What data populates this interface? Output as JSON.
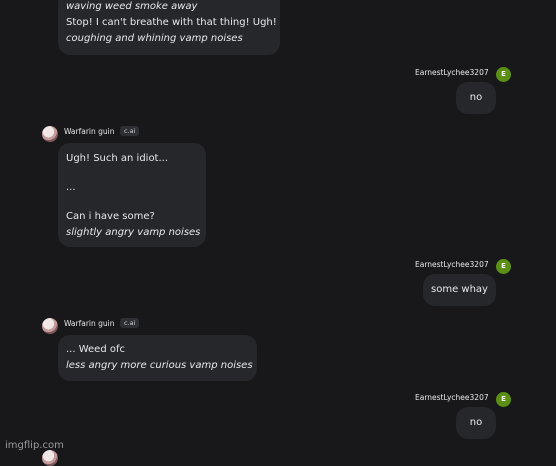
{
  "bot": {
    "name": "Warfarin guin",
    "tag": "c.ai"
  },
  "user": {
    "name": "EarnestLychee3207",
    "avatar_letter": "E"
  },
  "messages": [
    {
      "id": "m1",
      "from": "bot",
      "lines": [
        {
          "text": "waving weed smoke away",
          "italic": true
        },
        {
          "text": "Stop! I can't breathe with that thing! Ugh!",
          "italic": false
        },
        {
          "text": "coughing and whining vamp noises",
          "italic": true
        }
      ]
    },
    {
      "id": "m2",
      "from": "user",
      "text": "no"
    },
    {
      "id": "m3",
      "from": "bot",
      "lines": [
        {
          "text": "Ugh! Such an idiot...",
          "italic": false
        },
        {
          "text": "",
          "italic": false
        },
        {
          "text": "...",
          "italic": false
        },
        {
          "text": "",
          "italic": false
        },
        {
          "text": "Can i have some?",
          "italic": false
        },
        {
          "text": "slightly angry vamp noises",
          "italic": true
        }
      ]
    },
    {
      "id": "m4",
      "from": "user",
      "text": "some whay"
    },
    {
      "id": "m5",
      "from": "bot",
      "lines": [
        {
          "text": "... Weed ofc",
          "italic": false
        },
        {
          "text": "less angry more curious vamp noises",
          "italic": true
        }
      ]
    },
    {
      "id": "m6",
      "from": "user",
      "text": "no"
    }
  ],
  "watermark": "imgflip.com"
}
